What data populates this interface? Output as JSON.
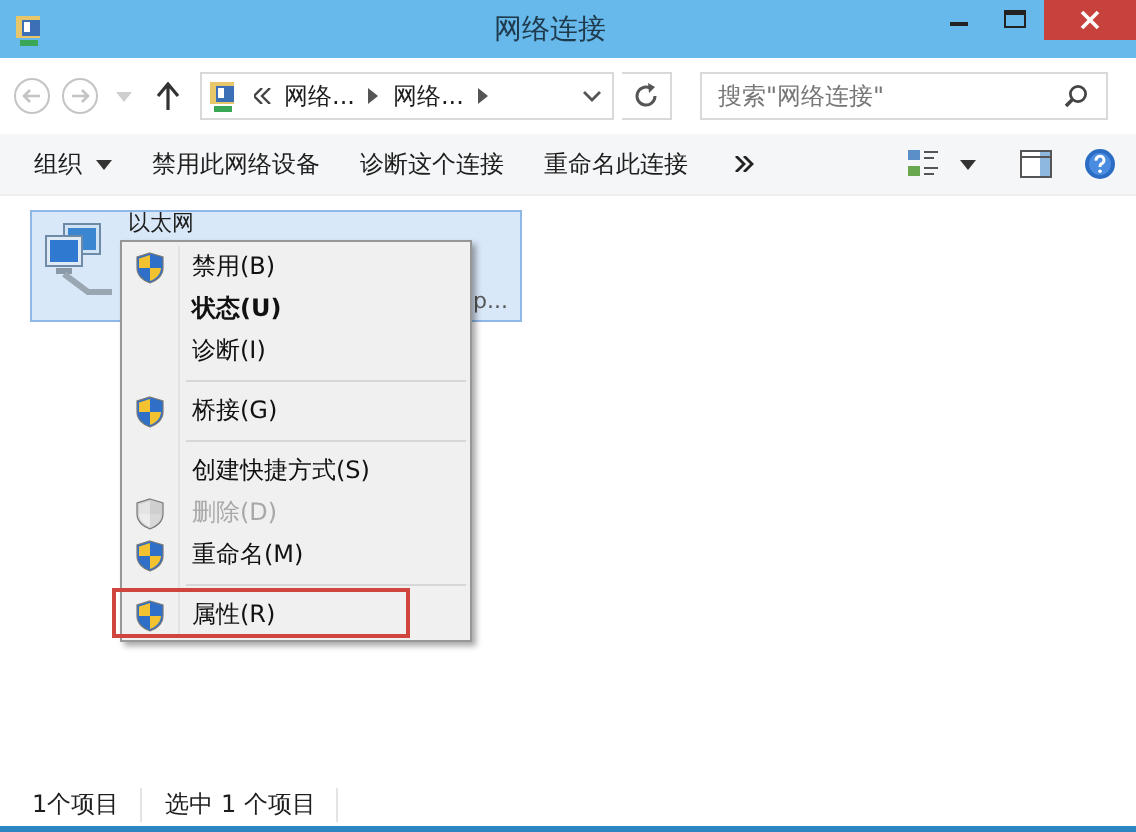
{
  "window": {
    "title": "网络连接"
  },
  "address_bar": {
    "segments": [
      "网络...",
      "网络..."
    ]
  },
  "search": {
    "placeholder": "搜索\"网络连接\""
  },
  "toolbar": {
    "items": [
      {
        "label": "组织",
        "kind": "menu"
      },
      {
        "label": "禁用此网络设备",
        "kind": "command"
      },
      {
        "label": "诊断这个连接",
        "kind": "command"
      },
      {
        "label": "重命名此连接",
        "kind": "command"
      }
    ]
  },
  "connection": {
    "name": "以太网",
    "detail_fragment": "p...",
    "selected": true
  },
  "context_menu": {
    "items": [
      {
        "label": "禁用(B)",
        "shield": true,
        "bold": false,
        "disabled": false,
        "separator_after": false,
        "annotated": false
      },
      {
        "label": "状态(U)",
        "shield": false,
        "bold": true,
        "disabled": false,
        "separator_after": false,
        "annotated": false
      },
      {
        "label": "诊断(I)",
        "shield": false,
        "bold": false,
        "disabled": false,
        "separator_after": true,
        "annotated": false
      },
      {
        "label": "桥接(G)",
        "shield": true,
        "bold": false,
        "disabled": false,
        "separator_after": true,
        "annotated": false
      },
      {
        "label": "创建快捷方式(S)",
        "shield": false,
        "bold": false,
        "disabled": false,
        "separator_after": false,
        "annotated": false
      },
      {
        "label": "删除(D)",
        "shield": true,
        "bold": false,
        "disabled": true,
        "separator_after": false,
        "annotated": false
      },
      {
        "label": "重命名(M)",
        "shield": true,
        "bold": false,
        "disabled": false,
        "separator_after": true,
        "annotated": false
      },
      {
        "label": "属性(R)",
        "shield": true,
        "bold": false,
        "disabled": false,
        "separator_after": false,
        "annotated": true
      }
    ]
  },
  "status_bar": {
    "items": [
      "1个项目",
      "选中 1 个项目"
    ]
  }
}
